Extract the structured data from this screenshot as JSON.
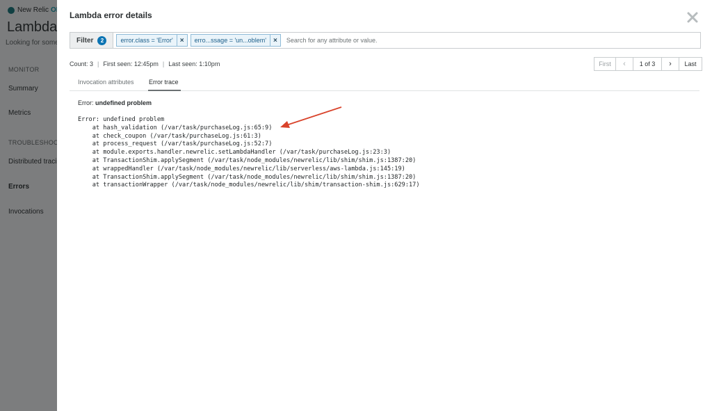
{
  "background_app": {
    "brand_name": "New Relic",
    "brand_suffix": "ONE",
    "title": "Lambda f",
    "subtitle": "Looking for some",
    "nav": {
      "monitor_heading": "MONITOR",
      "summary": "Summary",
      "metrics": "Metrics",
      "troubleshoot_heading": "TROUBLESHOOT",
      "distributed_tracing": "Distributed tracin",
      "errors": "Errors",
      "invocations": "Invocations"
    }
  },
  "modal": {
    "title": "Lambda error details",
    "filter": {
      "label": "Filter",
      "count": "2",
      "chips": [
        {
          "text": "error.class = 'Error'",
          "remove": "×"
        },
        {
          "text": "erro...ssage = 'un...oblem'",
          "remove": "×"
        }
      ],
      "search_placeholder": "Search for any attribute or value."
    },
    "meta": {
      "count": "Count: 3",
      "first_seen": "First seen: 12:45pm",
      "last_seen": "Last seen: 1:10pm",
      "separator": "|"
    },
    "pager": {
      "first": "First",
      "prev": "‹",
      "position": "1 of 3",
      "next": "›",
      "last": "Last"
    },
    "tabs": {
      "invocation_attributes": "Invocation attributes",
      "error_trace": "Error trace"
    },
    "error": {
      "label": "Error: ",
      "message": "undefined problem",
      "stack": [
        "Error: undefined problem",
        "    at hash_validation (/var/task/purchaseLog.js:65:9)",
        "    at check_coupon (/var/task/purchaseLog.js:61:3)",
        "    at process_request (/var/task/purchaseLog.js:52:7)",
        "    at module.exports.handler.newrelic.setLambdaHandler (/var/task/purchaseLog.js:23:3)",
        "    at TransactionShim.applySegment (/var/task/node_modules/newrelic/lib/shim/shim.js:1387:20)",
        "    at wrappedHandler (/var/task/node_modules/newrelic/lib/serverless/aws-lambda.js:145:19)",
        "    at TransactionShim.applySegment (/var/task/node_modules/newrelic/lib/shim/shim.js:1387:20)",
        "    at transactionWrapper (/var/task/node_modules/newrelic/lib/shim/transaction-shim.js:629:17)"
      ]
    }
  },
  "colors": {
    "accent_blue": "#0c74b3",
    "annotation_arrow": "#d9432b"
  }
}
